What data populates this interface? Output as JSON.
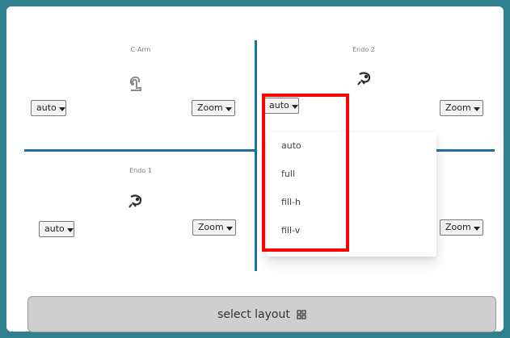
{
  "quadrants": {
    "top_left": {
      "title": "C-Arm",
      "fit": "auto",
      "zoom": "Zoom"
    },
    "top_right": {
      "title": "Endo 2",
      "fit": "auto",
      "zoom": "Zoom"
    },
    "bottom_left": {
      "title": "Endo 1",
      "fit": "auto",
      "zoom": "Zoom"
    },
    "bottom_right": {
      "zoom": "Zoom"
    }
  },
  "dropdown": {
    "options": [
      "auto",
      "full",
      "fill-h",
      "fill-v"
    ]
  },
  "footer": {
    "select_layout_label": "select layout"
  },
  "colors": {
    "frame": "#2f7f8e",
    "divider": "#1d6f9f",
    "highlight": "#ff0000",
    "button_bg": "#f3f3f3",
    "footer_bg": "#cfcfcf"
  },
  "icons": [
    "c-arm-icon",
    "endoscope-icon",
    "chevron-down-icon",
    "grid-layout-icon"
  ]
}
